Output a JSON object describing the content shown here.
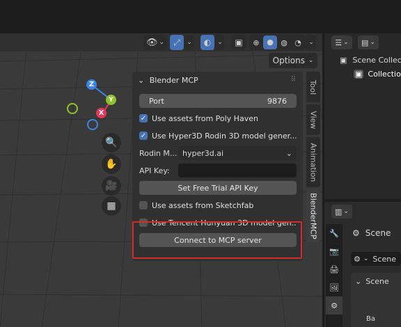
{
  "header": {
    "options_label": "Options"
  },
  "gizmo": {
    "z": "Z",
    "y": "Y",
    "x": "X"
  },
  "panel": {
    "title": "Blender MCP",
    "port_label": "Port",
    "port_value": "9876",
    "use_poly_haven": "Use assets from Poly Haven",
    "poly_haven_checked": true,
    "use_hyper3d": "Use Hyper3D Rodin 3D model gener...",
    "hyper3d_checked": true,
    "rodin_mode_label": "Rodin M...",
    "rodin_mode_value": "hyper3d.ai",
    "api_key_label": "API Key:",
    "api_key_value": "",
    "free_trial_button": "Set Free Trial API Key",
    "use_sketchfab": "Use assets from Sketchfab",
    "sketchfab_checked": false,
    "use_hunyuan": "Use Tencent Hunyuan 3D model gen...",
    "hunyuan_checked": false,
    "connect_button": "Connect to MCP server"
  },
  "sidebar_tabs": [
    "Tool",
    "View",
    "Animation",
    "BlenderMCP"
  ],
  "outliner": {
    "scene_collection": "Scene Collec",
    "collection": "Collection"
  },
  "properties": {
    "scene_label": "Scene",
    "scene_selector": "Scene",
    "scene_section": "Scene",
    "truncated_label": "Ba"
  },
  "colors": {
    "accent": "#4772b3",
    "highlight_box": "#d42a2a",
    "axis_x": "#e7365a",
    "axis_y": "#8fc32c",
    "axis_z": "#3a85e6"
  }
}
